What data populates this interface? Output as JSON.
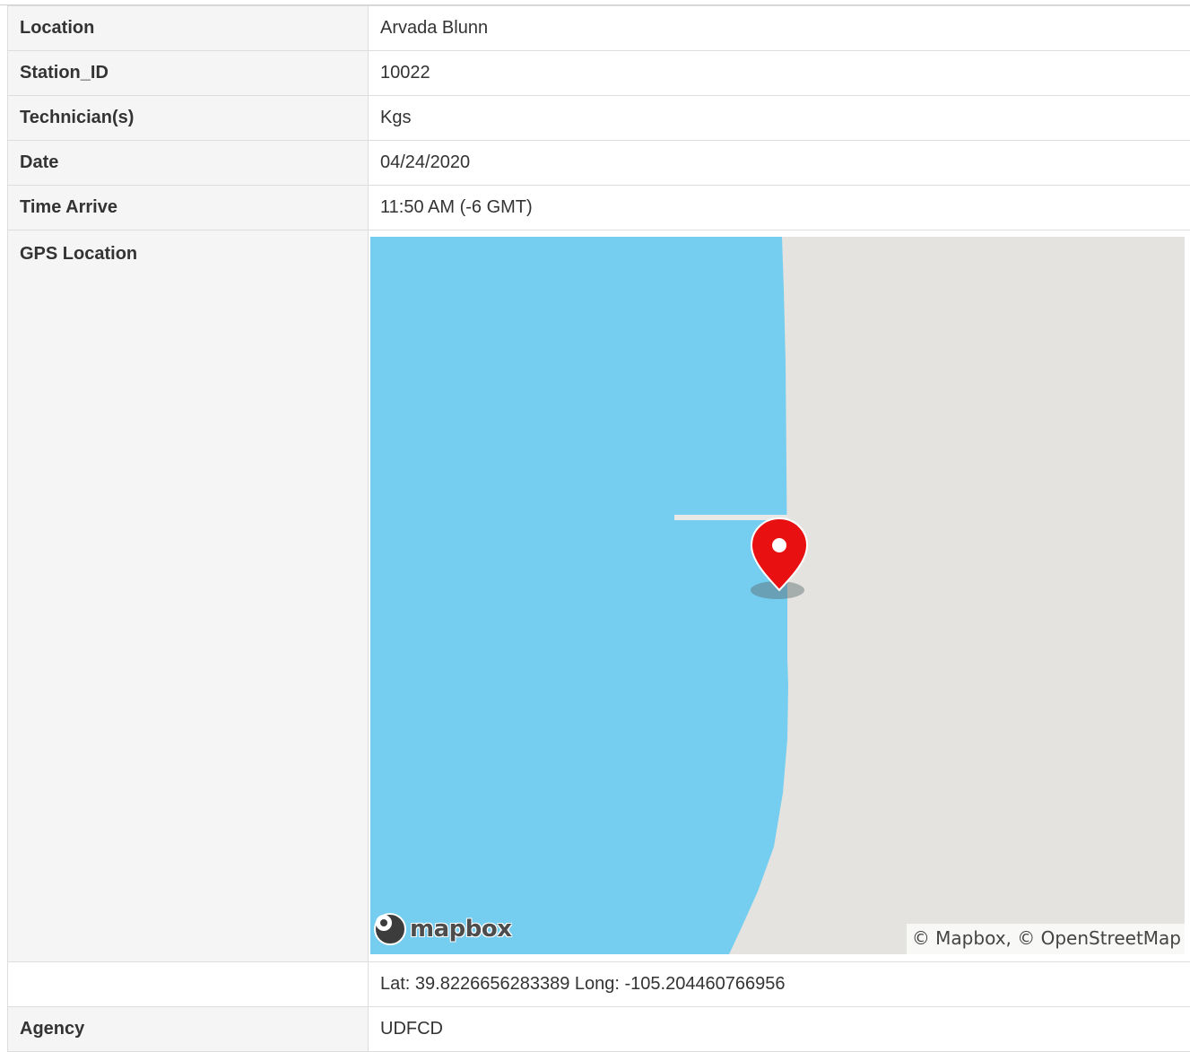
{
  "rows": {
    "location": {
      "label": "Location",
      "value": "Arvada Blunn"
    },
    "station_id": {
      "label": "Station_ID",
      "value": "10022"
    },
    "technicians": {
      "label": "Technician(s)",
      "value": "Kgs"
    },
    "date": {
      "label": "Date",
      "value": "04/24/2020"
    },
    "time_arrive": {
      "label": "Time Arrive",
      "value": "11:50 AM (-6 GMT)"
    },
    "gps_location": {
      "label": "GPS Location"
    },
    "coordinates": {
      "label": "",
      "value": "Lat: 39.8226656283389 Long: -105.204460766956"
    },
    "agency": {
      "label": "Agency",
      "value": "UDFCD"
    }
  },
  "map": {
    "logo_text": "mapbox",
    "attribution": "© Mapbox, © OpenStreetMap",
    "water_color": "#75cdef",
    "land_color": "#e4e3df",
    "marker_color": "#e81010",
    "marker_icon": "map-pin-icon"
  }
}
